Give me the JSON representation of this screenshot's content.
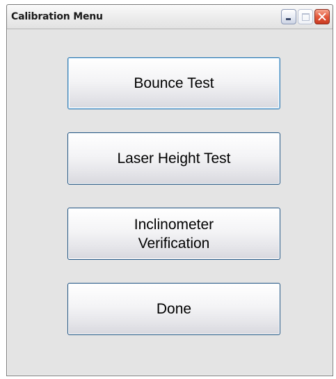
{
  "window": {
    "title": "Calibration Menu"
  },
  "buttons": {
    "bounce_test": "Bounce Test",
    "laser_height_test": "Laser Height Test",
    "inclinometer_verification_line1": "Inclinometer",
    "inclinometer_verification_line2": "Verification",
    "done": "Done"
  },
  "icons": {
    "minimize": "minimize-icon",
    "maximize": "maximize-icon",
    "close": "close-icon"
  },
  "colors": {
    "close_button": "#e4583b",
    "button_border": "#1c5180",
    "window_background": "#e4e4e4"
  }
}
